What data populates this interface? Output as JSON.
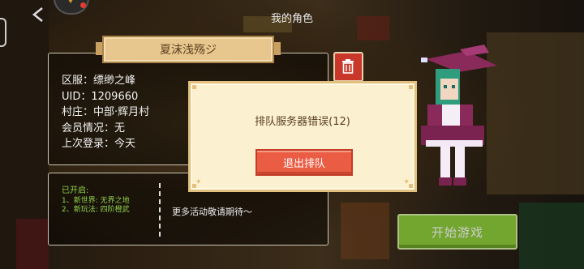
{
  "header": {
    "title": "我的角色"
  },
  "profile": {
    "name": "夏沫浅殇ジ",
    "region": "区服：缥缈之峰",
    "uid": "UID：1209660",
    "village": "村庄：中部·辉月村",
    "membership": "会员情况：无",
    "last_login": "上次登录：今天"
  },
  "activities": {
    "title": "已开启:",
    "items": [
      "1、新世界: 无界之地",
      "2、新玩法: 四阶橙武"
    ],
    "more": "更多活动敬请期待～"
  },
  "start_button": {
    "label": "开始游戏"
  },
  "dialog": {
    "message": "排队服务器错误(12)",
    "exit_label": "退出排队"
  },
  "colors": {
    "dialog_bg": "#fbf0d0",
    "exit_button": "#ea5c43",
    "start_button": "#8fcf3a",
    "green_text": "#8fd14a"
  },
  "icons": [
    "back-chevron-icon",
    "trash-icon",
    "ornament-icon"
  ]
}
